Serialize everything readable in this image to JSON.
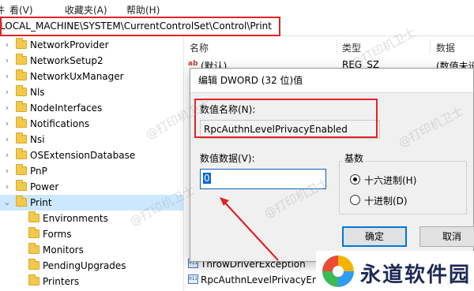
{
  "menubar": {
    "items": [
      "看(V)",
      "收藏夹(A)",
      "帮助(H)"
    ],
    "first_fragment": "件"
  },
  "address": {
    "path": "LOCAL_MACHINE\\SYSTEM\\CurrentControlSet\\Control\\Print"
  },
  "tree": {
    "items": [
      {
        "label": "NetworkProvider",
        "level": 0
      },
      {
        "label": "NetworkSetup2",
        "level": 0
      },
      {
        "label": "NetworkUxManager",
        "level": 0
      },
      {
        "label": "Nls",
        "level": 0
      },
      {
        "label": "NodeInterfaces",
        "level": 0
      },
      {
        "label": "Notifications",
        "level": 0
      },
      {
        "label": "Nsi",
        "level": 0
      },
      {
        "label": "OSExtensionDatabase",
        "level": 0
      },
      {
        "label": "PnP",
        "level": 0
      },
      {
        "label": "Power",
        "level": 0
      },
      {
        "label": "Print",
        "level": 0,
        "selected": true,
        "expanded": true
      },
      {
        "label": "Environments",
        "level": 1
      },
      {
        "label": "Forms",
        "level": 1
      },
      {
        "label": "Monitors",
        "level": 1
      },
      {
        "label": "PendingUpgrades",
        "level": 1
      },
      {
        "label": "Printers",
        "level": 1
      }
    ]
  },
  "list": {
    "headers": {
      "name": "名称",
      "type": "类型",
      "data": "数据"
    },
    "rows": [
      {
        "name": "(默认)",
        "type": "REG_SZ",
        "data": "(数值未设",
        "icon": "string-value-icon"
      },
      {
        "name": "ThrowDriverException",
        "icon": "dword-value-icon"
      },
      {
        "name": "RpcAuthnLevelPrivacyEnab",
        "icon": "dword-value-icon"
      }
    ]
  },
  "dialog": {
    "title": "编辑 DWORD (32 位)值",
    "name_label": "数值名称(N):",
    "name_value": "RpcAuthnLevelPrivacyEnabled",
    "data_label": "数值数据(V):",
    "data_value": "0",
    "base_label": "基数",
    "base_options": [
      {
        "label": "十六进制(H)",
        "selected": true
      },
      {
        "label": "十进制(D)",
        "selected": false
      }
    ],
    "ok_label": "确定",
    "cancel_label": "取消"
  },
  "watermark": {
    "text": "@打印机卫士"
  },
  "logo": {
    "text": "永道软件园"
  },
  "colors": {
    "highlight_red": "#e02424",
    "selection_blue": "#cce8ff",
    "accent": "#0078d7",
    "folder": "#f2c94c"
  }
}
